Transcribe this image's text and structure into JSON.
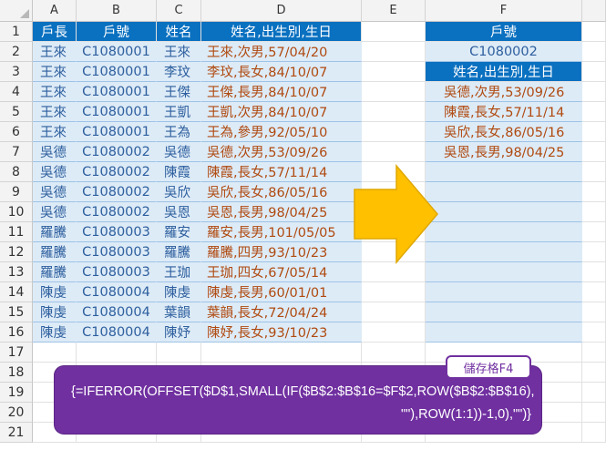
{
  "columns": [
    "A",
    "B",
    "C",
    "D",
    "E",
    "F"
  ],
  "rows": [
    "1",
    "2",
    "3",
    "4",
    "5",
    "6",
    "7",
    "8",
    "9",
    "10",
    "11",
    "12",
    "13",
    "14",
    "15",
    "16",
    "17",
    "18",
    "19",
    "20",
    "21"
  ],
  "left_table": {
    "headers": [
      "戶長",
      "戶號",
      "姓名",
      "姓名,出生別,生日"
    ],
    "records": [
      [
        "王來",
        "C1080001",
        "王來",
        "王來,次男,57/04/20"
      ],
      [
        "王來",
        "C1080001",
        "李玟",
        "李玟,長女,84/10/07"
      ],
      [
        "王來",
        "C1080001",
        "王傑",
        "王傑,長男,84/10/07"
      ],
      [
        "王來",
        "C1080001",
        "王凱",
        "王凱,次男,84/10/07"
      ],
      [
        "王來",
        "C1080001",
        "王為",
        "王為,參男,92/05/10"
      ],
      [
        "吳德",
        "C1080002",
        "吳德",
        "吳德,次男,53/09/26"
      ],
      [
        "吳德",
        "C1080002",
        "陳霞",
        "陳霞,長女,57/11/14"
      ],
      [
        "吳德",
        "C1080002",
        "吳欣",
        "吳欣,長女,86/05/16"
      ],
      [
        "吳德",
        "C1080002",
        "吳恩",
        "吳恩,長男,98/04/25"
      ],
      [
        "羅騰",
        "C1080003",
        "羅安",
        "羅安,長男,101/05/05"
      ],
      [
        "羅騰",
        "C1080003",
        "羅騰",
        "羅騰,四男,93/10/23"
      ],
      [
        "羅騰",
        "C1080003",
        "王珈",
        "王珈,四女,67/05/14"
      ],
      [
        "陳虔",
        "C1080004",
        "陳虔",
        "陳虔,長男,60/01/01"
      ],
      [
        "陳虔",
        "C1080004",
        "葉韻",
        "葉韻,長女,72/04/24"
      ],
      [
        "陳虔",
        "C1080004",
        "陳妤",
        "陳妤,長女,93/10/23"
      ]
    ]
  },
  "right_table": {
    "header1": "戶號",
    "lookup_value": "C1080002",
    "header2": "姓名,出生別,生日",
    "results": [
      "吳德,次男,53/09/26",
      "陳霞,長女,57/11/14",
      "吳欣,長女,86/05/16",
      "吳恩,長男,98/04/25",
      "",
      "",
      "",
      "",
      "",
      "",
      "",
      "",
      ""
    ]
  },
  "callout": {
    "tag": "儲存格F4",
    "formula_line1": "{=IFERROR(OFFSET($D$1,SMALL(IF($B$2:$B$16=$F$2,ROW($B$2:$B$16),",
    "formula_line2": "\"\"),ROW(1:1))-1,0),\"\")}"
  },
  "colors": {
    "header_blue": "#0a70c0",
    "data_fill": "#ddebf7",
    "arrow": "#ffc000",
    "callout": "#7030a0"
  }
}
